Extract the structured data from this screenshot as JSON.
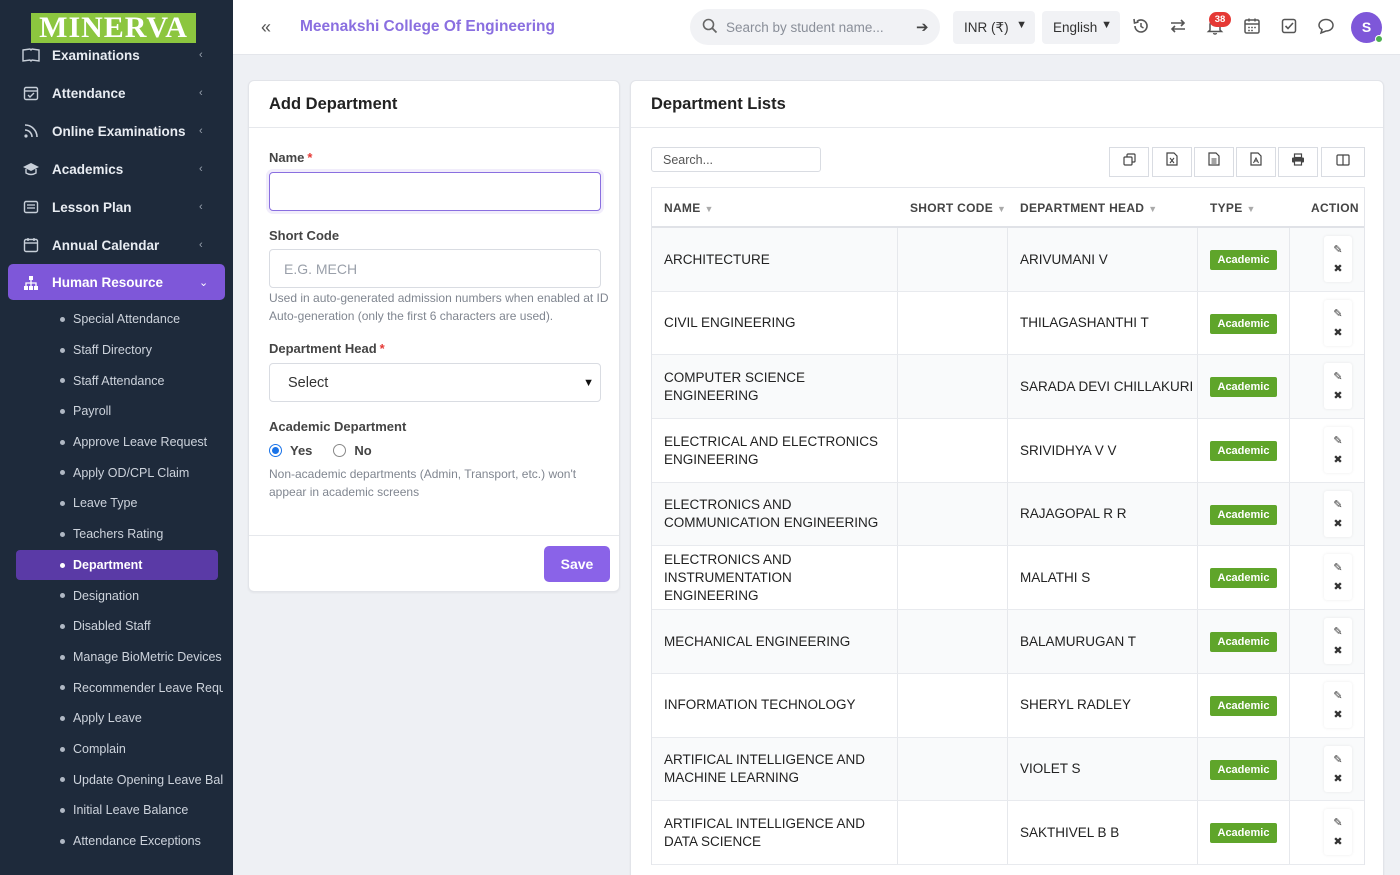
{
  "brand": {
    "logo_text": "MINERVA"
  },
  "sidebar": {
    "items": [
      {
        "label": "Examinations",
        "icon": "book-icon"
      },
      {
        "label": "Attendance",
        "icon": "calendar-check-icon"
      },
      {
        "label": "Online Examinations",
        "icon": "rss-icon"
      },
      {
        "label": "Academics",
        "icon": "graduation-cap-icon"
      },
      {
        "label": "Lesson Plan",
        "icon": "list-icon"
      },
      {
        "label": "Annual Calendar",
        "icon": "calendar-icon"
      },
      {
        "label": "Human Resource",
        "icon": "sitemap-icon"
      }
    ],
    "submenu": [
      "Special Attendance",
      "Staff Directory",
      "Staff Attendance",
      "Payroll",
      "Approve Leave Request",
      "Apply OD/CPL Claim",
      "Leave Type",
      "Teachers Rating",
      "Department",
      "Designation",
      "Disabled Staff",
      "Manage BioMetric Devices",
      "Recommender Leave Request",
      "Apply Leave",
      "Complain",
      "Update Opening Leave Balance",
      "Initial Leave Balance",
      "Attendance Exceptions"
    ]
  },
  "topbar": {
    "college_name": "Meenakshi College Of Engineering",
    "search_placeholder": "Search by student name...",
    "currency": "INR (₹)",
    "language": "English",
    "notification_count": "38",
    "avatar_initial": "S"
  },
  "add_form": {
    "title": "Add Department",
    "name_label": "Name",
    "short_code_label": "Short Code",
    "short_code_placeholder": "E.G. MECH",
    "short_code_help": "Used in auto-generated admission numbers when enabled at ID Auto-generation (only the first 6 characters are used).",
    "dept_head_label": "Department Head",
    "dept_head_value": "Select",
    "academic_label": "Academic Department",
    "yes_label": "Yes",
    "no_label": "No",
    "academic_help": "Non-academic departments (Admin, Transport, etc.) won't appear in academic screens",
    "required_mark": "*",
    "save_label": "Save"
  },
  "list": {
    "title": "Department Lists",
    "search_placeholder": "Search...",
    "columns": [
      "NAME",
      "SHORT CODE",
      "DEPARTMENT HEAD",
      "TYPE",
      "ACTION"
    ],
    "rows": [
      {
        "name": "ARCHITECTURE",
        "short_code": "",
        "head": "ARIVUMANI V",
        "type": "Academic"
      },
      {
        "name": "CIVIL ENGINEERING",
        "short_code": "",
        "head": "THILAGASHANTHI T",
        "type": "Academic"
      },
      {
        "name": "COMPUTER SCIENCE ENGINEERING",
        "short_code": "",
        "head": "SARADA DEVI CHILLAKURI",
        "type": "Academic"
      },
      {
        "name": "ELECTRICAL AND ELECTRONICS ENGINEERING",
        "short_code": "",
        "head": "SRIVIDHYA V V",
        "type": "Academic"
      },
      {
        "name": "ELECTRONICS AND COMMUNICATION ENGINEERING",
        "short_code": "",
        "head": "RAJAGOPAL R R",
        "type": "Academic"
      },
      {
        "name": "ELECTRONICS AND INSTRUMENTATION ENGINEERING",
        "short_code": "",
        "head": "MALATHI S",
        "type": "Academic"
      },
      {
        "name": "MECHANICAL ENGINEERING",
        "short_code": "",
        "head": "BALAMURUGAN T",
        "type": "Academic"
      },
      {
        "name": "INFORMATION TECHNOLOGY",
        "short_code": "",
        "head": "SHERYL RADLEY",
        "type": "Academic"
      },
      {
        "name": "ARTIFICAL INTELLIGENCE AND MACHINE LEARNING",
        "short_code": "",
        "head": "VIOLET S",
        "type": "Academic"
      },
      {
        "name": "ARTIFICAL INTELLIGENCE AND DATA SCIENCE",
        "short_code": "",
        "head": "SAKTHIVEL B B",
        "type": "Academic"
      }
    ]
  },
  "colors": {
    "sidebar_bg": "#1e2a3b",
    "accent": "#7e57d9",
    "academic_badge": "#5fa52a",
    "logo_bg": "#8cc63f"
  }
}
